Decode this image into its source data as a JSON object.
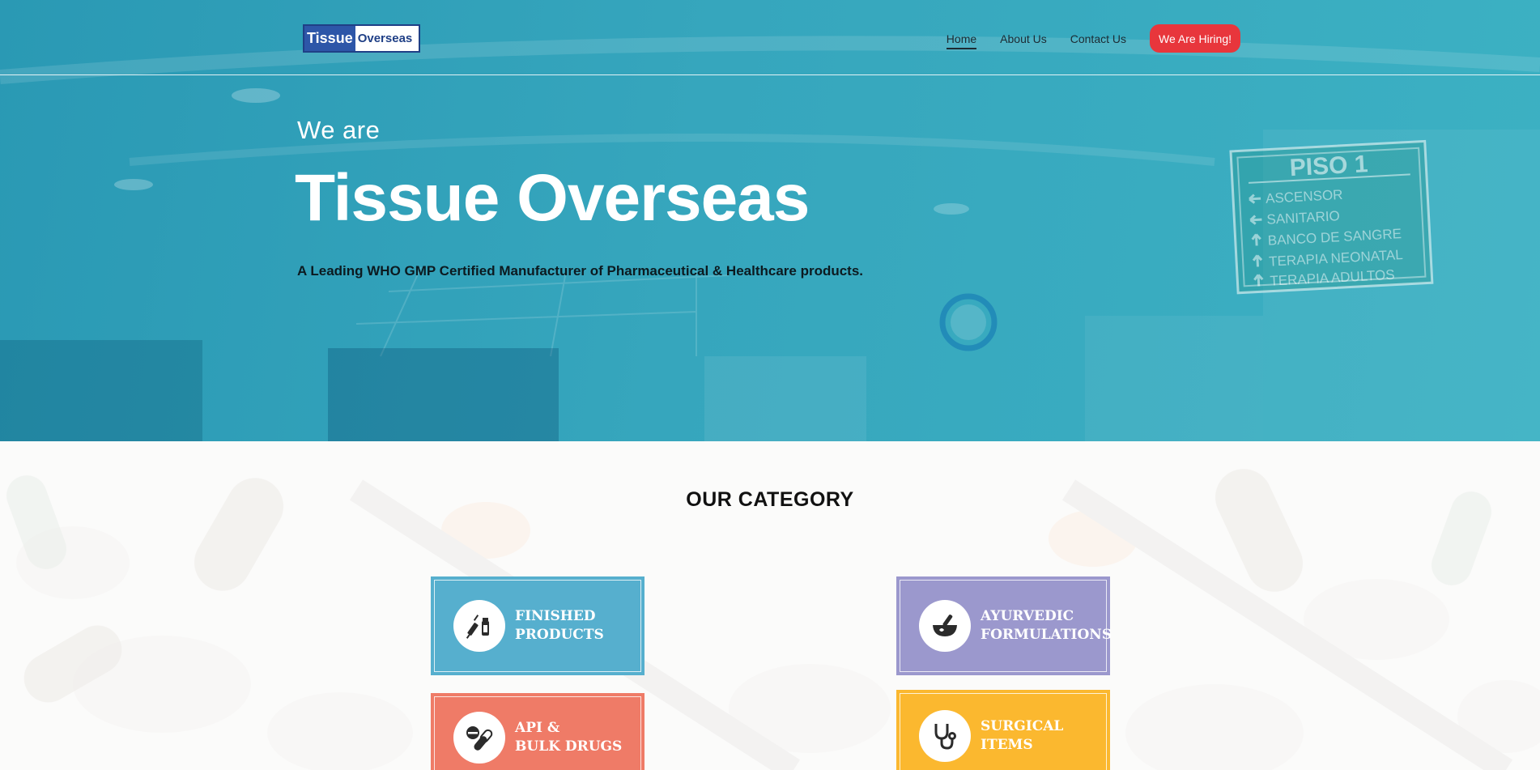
{
  "header": {
    "logo": {
      "part1": "Tissue",
      "part2": "Overseas"
    },
    "nav": [
      {
        "label": "Home",
        "active": true
      },
      {
        "label": "About Us",
        "active": false
      },
      {
        "label": "Contact Us",
        "active": false
      }
    ],
    "cta_label": "We Are Hiring!"
  },
  "hero": {
    "intro": "We are",
    "title": "Tissue Overseas",
    "tagline": "A Leading WHO GMP Certified Manufacturer of Pharmaceutical & Healthcare products.",
    "background_sign": {
      "title": "PISO 1",
      "lines": [
        "ASCENSOR",
        "SANITARIO",
        "BANCO DE SANGRE",
        "TERAPIA NEONATAL",
        "TERAPIA ADULTOS"
      ]
    }
  },
  "category": {
    "heading": "OUR CATEGORY",
    "cards": [
      {
        "line1": "FINISHED",
        "line2": "PRODUCTS",
        "icon": "syringe-vial-icon",
        "color": "#56afce"
      },
      {
        "line1": "AYURVEDIC",
        "line2": "FORMULATIONS",
        "icon": "mortar-pestle-icon",
        "color": "#9b98cd"
      },
      {
        "line1": "API &",
        "line2": "BULK DRUGS",
        "icon": "pills-capsule-icon",
        "color": "#ef7b67"
      },
      {
        "line1": "SURGICAL",
        "line2": "ITEMS",
        "icon": "stethoscope-icon",
        "color": "#fbb82f"
      }
    ]
  },
  "colors": {
    "hero_teal": "#36a6bd",
    "cta_red": "#e8363c",
    "logo_blue": "#2d56a8"
  }
}
